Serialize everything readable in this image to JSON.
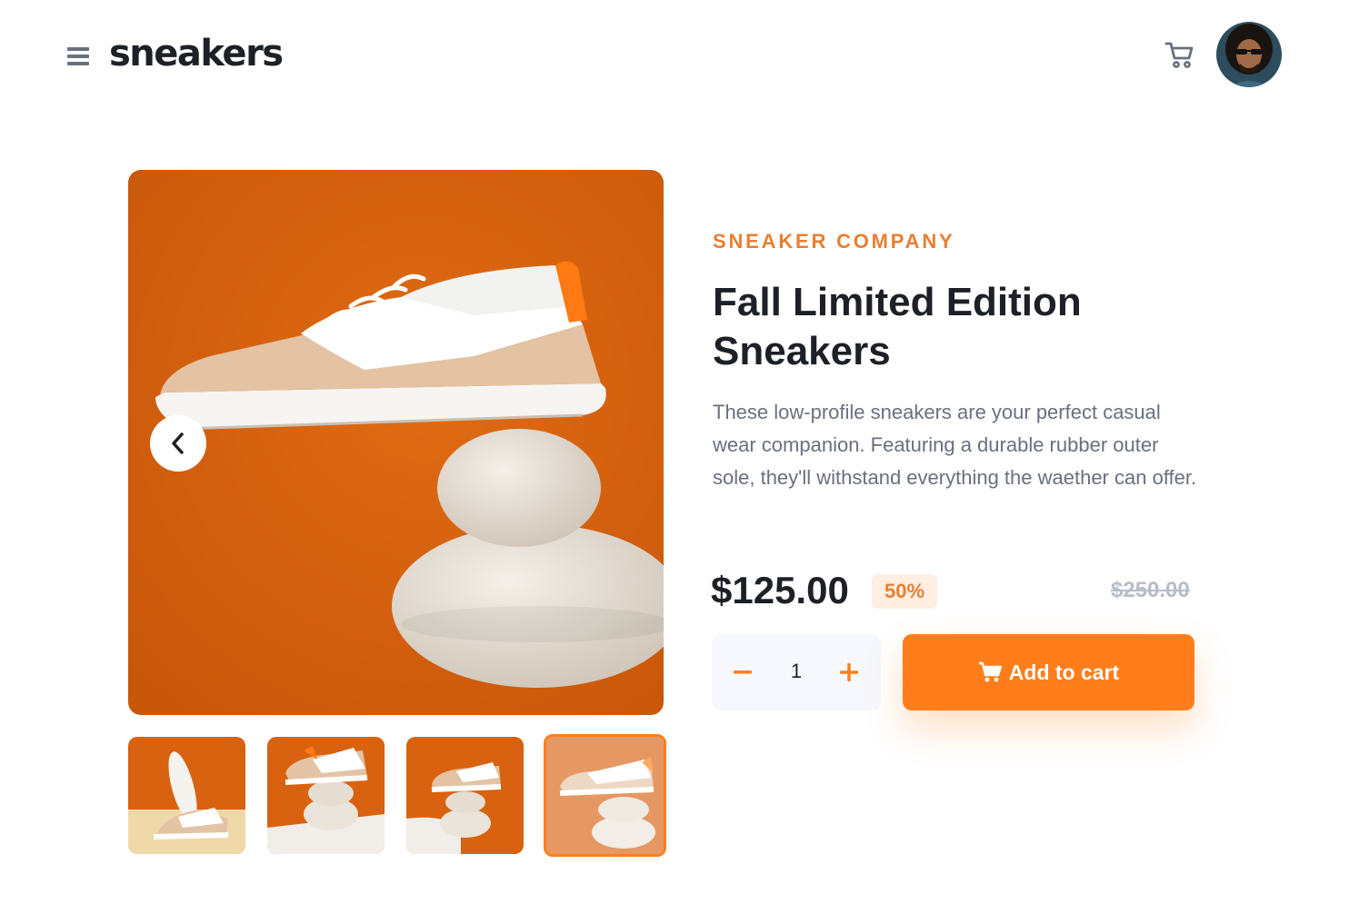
{
  "header": {
    "logo": "sneakers",
    "icons": {
      "menu": "hamburger-menu-icon",
      "cart": "cart-icon",
      "avatar": "user-avatar"
    }
  },
  "gallery": {
    "main_image": "sneaker-on-stacked-stones-photo",
    "prev_icon": "chevron-left-icon",
    "thumbnails": [
      {
        "name": "thumbnail-1"
      },
      {
        "name": "thumbnail-2"
      },
      {
        "name": "thumbnail-3"
      },
      {
        "name": "thumbnail-4",
        "selected": true
      }
    ]
  },
  "product": {
    "company": "SNEAKER COMPANY",
    "title": "Fall Limited Edition Sneakers",
    "description": "These low-profile sneakers are your perfect casual wear companion. Featuring a durable rubber outer sole, they'll withstand everything the waether can offer.",
    "price": "$125.00",
    "discount": "50%",
    "original_price": "$250.00"
  },
  "cart_controls": {
    "quantity": "1",
    "add_label": "Add to cart"
  },
  "colors": {
    "accent": "#ff7e1b",
    "accent_text": "#e77f33",
    "accent_pale": "#ffeee2",
    "dark_text": "#1d2026",
    "muted_text": "#69707d",
    "strike_text": "#b6bcc8",
    "photo_background": "#d8620f"
  }
}
